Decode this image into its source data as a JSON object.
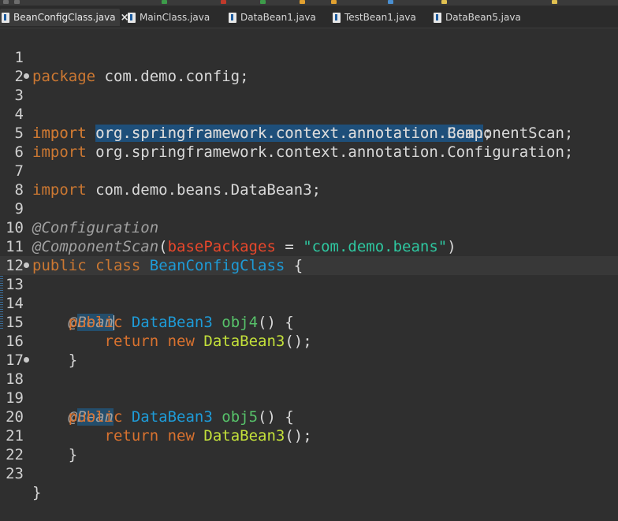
{
  "tabs": [
    {
      "label": "BeanConfigClass.java",
      "active": true,
      "close_icon": "×"
    },
    {
      "label": "MainClass.java",
      "active": false
    },
    {
      "label": "DataBean1.java",
      "active": false
    },
    {
      "label": "TestBean1.java",
      "active": false
    },
    {
      "label": "DataBean5.java",
      "active": false
    }
  ],
  "editor": {
    "line_numbers": [
      "1",
      "2",
      "3",
      "4",
      "5",
      "6",
      "7",
      "8",
      "9",
      "10",
      "11",
      "12",
      "13",
      "14",
      "15",
      "16",
      "17",
      "18",
      "19",
      "20",
      "21",
      "22",
      "23"
    ],
    "tokens": {
      "package_kw": "package",
      "package_name": "com.demo.config;",
      "import_kw": "import",
      "import_bean": "org.springframework.context.annotation.Bean",
      "semicolon": ";",
      "import_component_scan": "org.springframework.context.annotation.ComponentScan;",
      "import_configuration": "org.springframework.context.annotation.Configuration;",
      "import_databean3": "com.demo.beans.DataBean3;",
      "ann_configuration": "@Configuration",
      "ann_component_scan": "@ComponentScan",
      "paren_open": "(",
      "base_packages": "basePackages",
      "equals": " = ",
      "string_value": "\"com.demo.beans\"",
      "paren_close": ")",
      "public_kw": "public",
      "class_kw": "class",
      "class_name": "BeanConfigClass",
      "brace_open": "{",
      "brace_close": "}",
      "ann_at": "@",
      "ann_bean": "Bean",
      "type_databean3": "DataBean3",
      "method_obj4": "obj4",
      "method_obj5": "obj5",
      "method_parens": "() {",
      "return_kw": "return",
      "new_kw": "new",
      "ctor_call": "();"
    }
  },
  "colors": {
    "background": "#2f2f2f",
    "keyword": "#cc7832",
    "type": "#1e9bd7",
    "method": "#57c26a",
    "class_ref": "#c3e03a",
    "string": "#2ec7a0",
    "annotation": "#a0a0a0",
    "parameter": "#e8472b",
    "selection": "#1e4f7a"
  }
}
